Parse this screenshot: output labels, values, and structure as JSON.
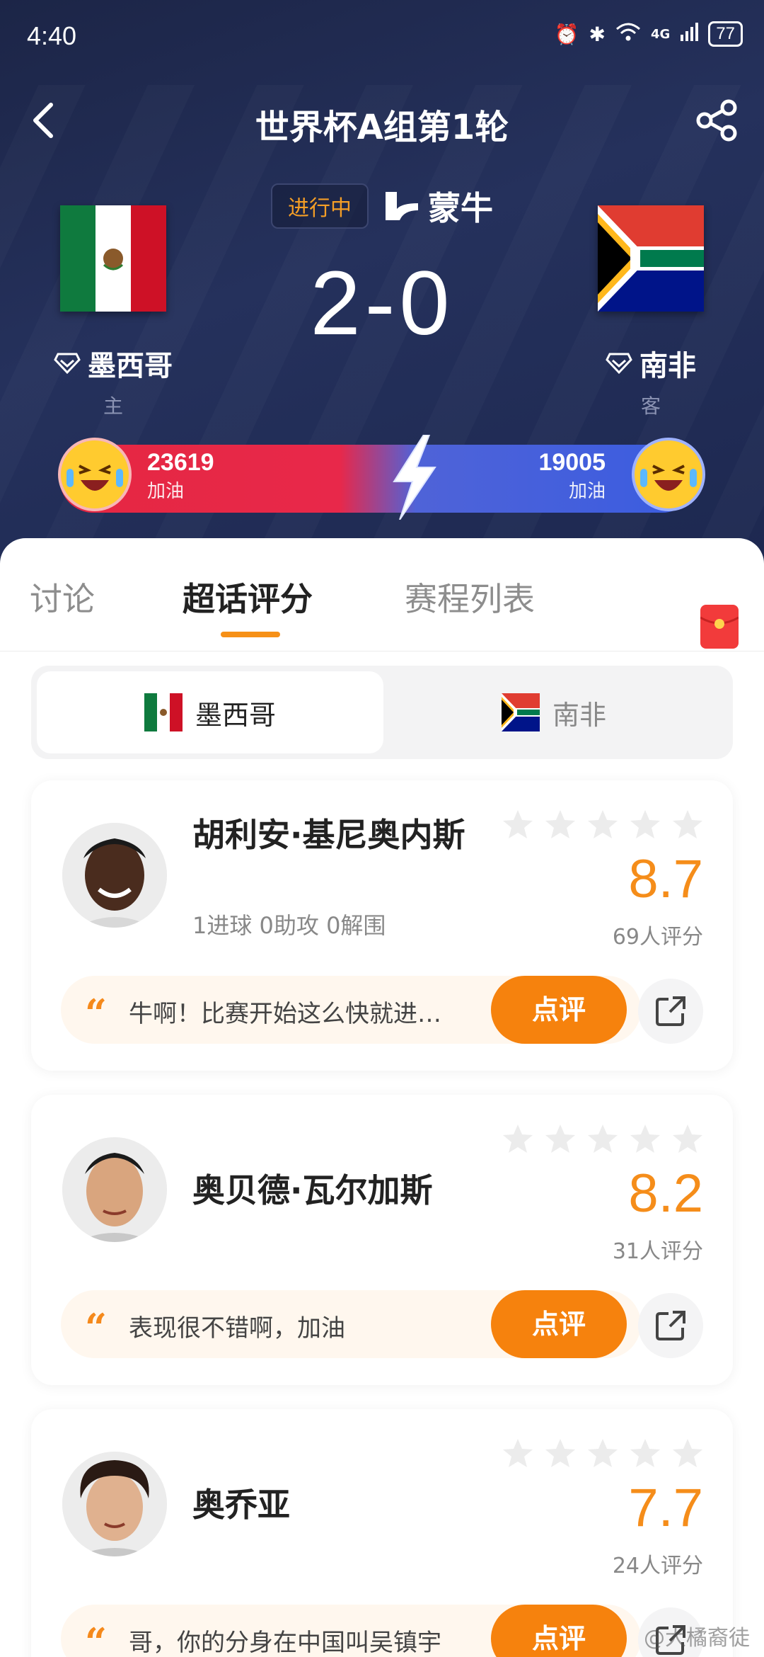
{
  "status_bar": {
    "time": "4:40",
    "network": "4G",
    "battery": "77"
  },
  "header": {
    "title": "世界杯A组第1轮"
  },
  "match": {
    "status": "进行中",
    "sponsor": "蒙牛",
    "score": "2-0",
    "home": {
      "name": "墨西哥",
      "role": "主"
    },
    "away": {
      "name": "南非",
      "role": "客"
    }
  },
  "cheer": {
    "home_count": "23619",
    "home_label": "加油",
    "away_count": "19005",
    "away_label": "加油",
    "colors": {
      "home": "#e8284a",
      "away": "#3a5ce0"
    }
  },
  "tabs": [
    {
      "label": "讨论"
    },
    {
      "label": "超话评分"
    },
    {
      "label": "赛程列表"
    }
  ],
  "team_switch": [
    {
      "label": "墨西哥"
    },
    {
      "label": "南非"
    }
  ],
  "players": [
    {
      "name": "胡利安·基尼奥内斯",
      "stats": "1进球 0助攻 0解围",
      "rating": "8.7",
      "raters": "69人评分",
      "comment": "牛啊！比赛开始这么快就进…",
      "button": "点评"
    },
    {
      "name": "奥贝德·瓦尔加斯",
      "rating": "8.2",
      "raters": "31人评分",
      "comment": "表现很不错啊，加油",
      "button": "点评"
    },
    {
      "name": "奥乔亚",
      "rating": "7.7",
      "raters": "24人评分",
      "comment": "哥，你的分身在中国叫吴镇宇",
      "button": "点评"
    }
  ],
  "watermark": "@大橘裔徒",
  "accent_color": "#f6820d"
}
